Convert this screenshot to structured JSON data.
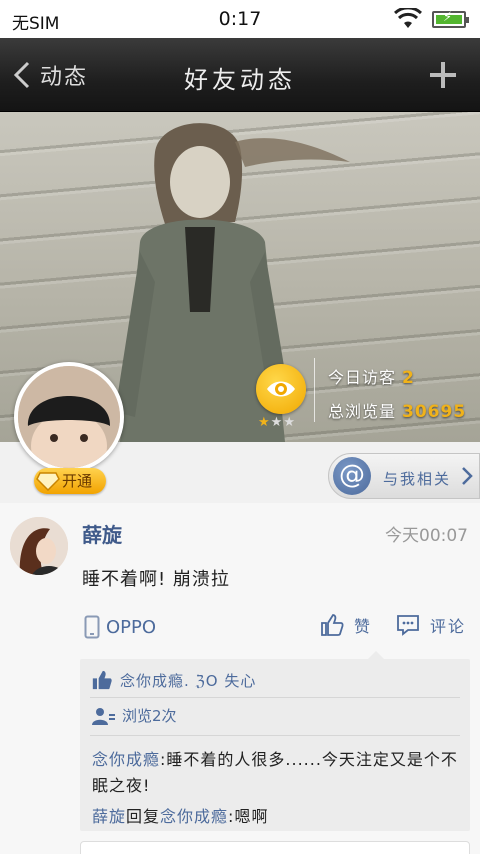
{
  "status_bar": {
    "carrier": "无SIM",
    "time": "0:17"
  },
  "nav": {
    "back_label": "动态",
    "title": "好友动态"
  },
  "profile": {
    "vip_label": "开通",
    "visitors_today_label": "今日访客",
    "visitors_today_value": "2",
    "total_views_label": "总浏览量",
    "total_views_value": "30695",
    "rating_stars": 1,
    "rating_max": 3,
    "at_me_label": "与我相关"
  },
  "post": {
    "author": "薛旋",
    "time": "今天00:07",
    "text": "睡不着啊! 崩溃拉",
    "device": "OPPO",
    "like_label": "赞",
    "comment_label": "评论",
    "likes_text": "念你成瘾. ℨO 失心",
    "views_text": "浏览2次",
    "comment1_author": "念你成瘾",
    "comment1_text": ":睡不着的人很多......今天注定又是个不眠之夜!",
    "comment2_author": "薛旋",
    "comment2_mid": "回复",
    "comment2_target": "念你成瘾",
    "comment2_text": ":嗯啊"
  },
  "colors": {
    "accent": "#4d6b9c",
    "gold": "#f0b21a",
    "nav_bg": "#1e1e1e"
  }
}
